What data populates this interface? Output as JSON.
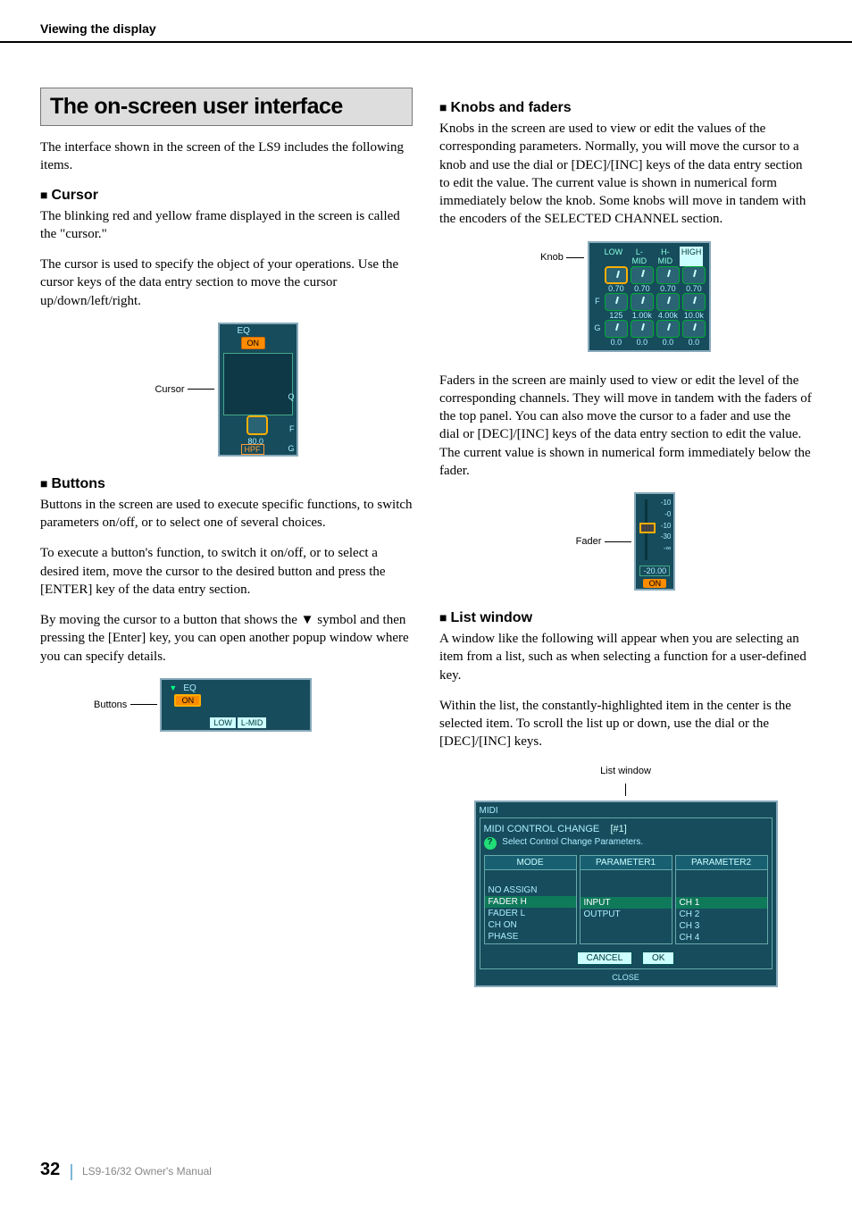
{
  "header": {
    "section_title": "Viewing the display"
  },
  "left": {
    "title": "The on-screen user interface",
    "intro": "The interface shown in the screen of the LS9 includes the following items.",
    "cursor": {
      "heading": "Cursor",
      "p1": "The blinking red and yellow frame displayed in the screen is called the \"cursor.\"",
      "p2": "The cursor is used to specify the object of your operations. Use the cursor keys of the data entry section to move the cursor up/down/left/right.",
      "fig_label": "Cursor",
      "eq_label": "EQ",
      "on_label": "ON",
      "hpf_label": "HPF",
      "val": "80.0",
      "side_q": "Q",
      "side_f": "F",
      "side_g": "G"
    },
    "buttons": {
      "heading": "Buttons",
      "p1": "Buttons in the screen are used to execute specific functions, to switch parameters on/off, or to select one of several choices.",
      "p2": "To execute a button's function, to switch it on/off, or to select a desired item, move the cursor to the desired button and press the [ENTER] key of the data entry section.",
      "p3": "By moving the cursor to a button that shows the ▼ symbol and then pressing the [Enter] key, you can open another popup window where you can specify details.",
      "fig_label": "Buttons",
      "eq_label_2": "EQ",
      "on_label_2": "ON",
      "tab_low": "LOW",
      "tab_lmid": "L-MID"
    }
  },
  "right": {
    "knobs": {
      "heading": "Knobs and faders",
      "p1": "Knobs in the screen are used to view or edit the values of the corresponding parameters. Normally, you will move the cursor to a knob and use the dial or [DEC]/[INC] keys of the data entry section to edit the value. The current value is shown in numerical form immediately below the knob. Some knobs will move in tandem with the encoders of the SELECTED CHANNEL section.",
      "fig_label": "Knob",
      "bands": [
        "LOW",
        "L-MID",
        "H-MID",
        "HIGH"
      ],
      "row_q": [
        "0.70",
        "0.70",
        "0.70",
        "0.70"
      ],
      "row_f": [
        "125",
        "1.00k",
        "4.00k",
        "10.0k"
      ],
      "row_g": [
        "0.0",
        "0.0",
        "0.0",
        "0.0"
      ],
      "side_f": "F",
      "side_g": "G"
    },
    "faders": {
      "p1": "Faders in the screen are mainly used to view or edit the level of the corresponding channels. They will move in tandem with the faders of the top panel. You can also move the cursor to a fader and use the dial or [DEC]/[INC] keys of the data entry section to edit the value. The current value is shown in numerical form immediately below the fader.",
      "fig_label": "Fader",
      "scale": [
        "-10",
        "-0",
        "-10",
        "-30",
        "-∞"
      ],
      "val": "-20.00",
      "on": "ON"
    },
    "list": {
      "heading": "List window",
      "p1": "A window like the following will appear when you are selecting an item from a list, such as when selecting a function for a user-defined key.",
      "p2": "Within the list, the constantly-highlighted item in the center is the selected item. To scroll the list up or down, use the dial or the [DEC]/[INC] keys.",
      "fig_label": "List window",
      "topbar": "MIDI",
      "win_title_a": "MIDI CONTROL CHANGE",
      "win_title_b": "[#1]",
      "subtitle": "Select Control Change Parameters.",
      "col1_hdr": "MODE",
      "col2_hdr": "PARAMETER1",
      "col3_hdr": "PARAMETER2",
      "col1_items": [
        "NO ASSIGN",
        "FADER H",
        "FADER L",
        "CH ON",
        "PHASE"
      ],
      "col2_items": [
        "INPUT",
        "OUTPUT"
      ],
      "col3_items": [
        "CH 1",
        "CH 2",
        "CH 3",
        "CH 4"
      ],
      "cancel": "CANCEL",
      "ok": "OK",
      "close": "CLOSE"
    }
  },
  "footer": {
    "page": "32",
    "manual": "LS9-16/32  Owner's Manual"
  }
}
